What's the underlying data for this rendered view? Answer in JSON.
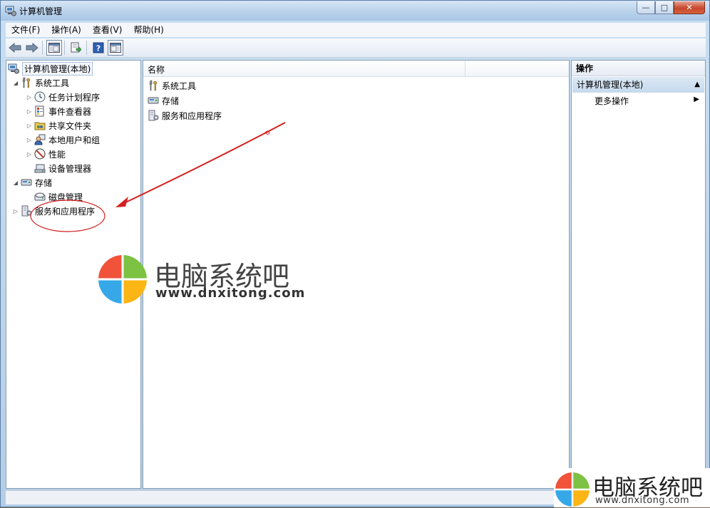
{
  "window": {
    "title": "计算机管理",
    "controls": {
      "minimize": "—",
      "maximize": "□",
      "close": "✕"
    }
  },
  "menubar": {
    "items": [
      "文件(F)",
      "操作(A)",
      "查看(V)",
      "帮助(H)"
    ]
  },
  "toolbar": {
    "icons": [
      "back-arrow-icon",
      "forward-arrow-icon",
      "show-hide-tree-icon",
      "export-list-icon",
      "help-icon",
      "action-pane-icon"
    ]
  },
  "tree": {
    "root": "计算机管理(本地)",
    "system_tools": {
      "label": "系统工具",
      "children": [
        "任务计划程序",
        "事件查看器",
        "共享文件夹",
        "本地用户和组",
        "性能",
        "设备管理器"
      ]
    },
    "storage": {
      "label": "存储",
      "children": [
        "磁盘管理"
      ]
    },
    "services": "服务和应用程序"
  },
  "center": {
    "column_header": "名称",
    "items": [
      "系统工具",
      "存储",
      "服务和应用程序"
    ]
  },
  "actions": {
    "header": "操作",
    "group": "计算机管理(本地)",
    "more": "更多操作"
  },
  "watermark": {
    "brand": "电脑系统吧",
    "url": "www.dnxitong.com"
  },
  "colors": {
    "accent": "#c8dcf0",
    "annotation_red": "#d42020",
    "logo_red": "#f0523a",
    "logo_green": "#7dc243",
    "logo_blue": "#36a8e8",
    "logo_yellow": "#fbb514"
  }
}
